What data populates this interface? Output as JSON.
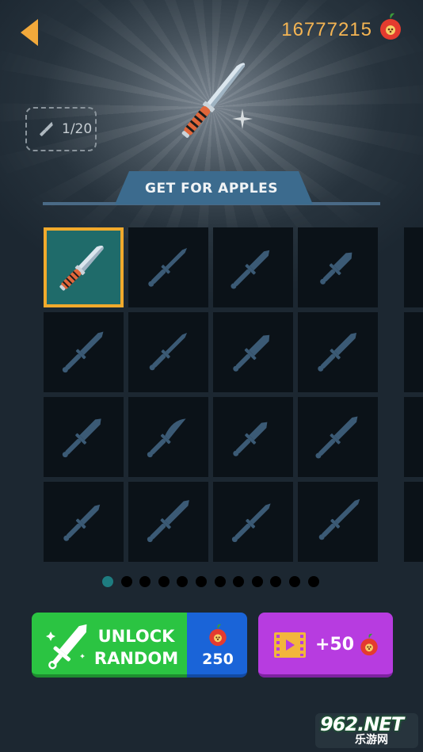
{
  "header": {
    "back_icon": "chevron-left-icon",
    "apple_count": "16777215",
    "apple_icon": "apple-icon"
  },
  "progress": {
    "text": "1/20",
    "icon": "knife-icon"
  },
  "banner": {
    "label": "GET FOR APPLES"
  },
  "knife_grid": {
    "rows": 4,
    "columns": 4,
    "selected_index": 0,
    "locked_color": "#3b5a75",
    "unlocked_color": "#1f6b6a",
    "selection_color": "#f1aa2c"
  },
  "pagination": {
    "pages": 12,
    "active_page": 1
  },
  "unlock_button": {
    "label": "UNLOCK\nRANDOM",
    "price": "250",
    "color": "#2bc442",
    "price_color": "#1a64d8"
  },
  "video_button": {
    "label": "+50",
    "icon": "video-icon",
    "color": "#b73ce0"
  },
  "watermark": {
    "brand": "962.NET",
    "text": "乐游网"
  }
}
